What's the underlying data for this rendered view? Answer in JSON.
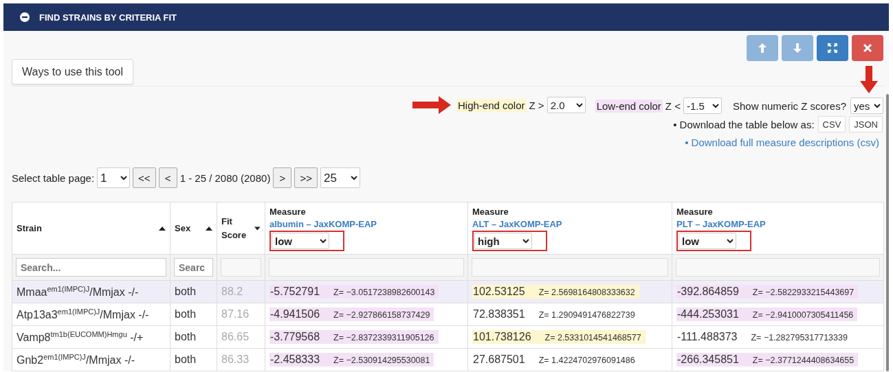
{
  "panel": {
    "title": "FIND STRAINS BY CRITERIA FIT",
    "expanded": true
  },
  "toolbar": [
    {
      "kind": "up",
      "disabled": true
    },
    {
      "kind": "down",
      "disabled": true
    },
    {
      "kind": "expand",
      "disabled": false
    },
    {
      "kind": "close",
      "disabled": false
    }
  ],
  "help_button": "Ways to use this tool",
  "options": [
    {
      "kind": "high",
      "label": "High-end color",
      "operator": "Z >",
      "value": "2.0",
      "arrow_left": true,
      "arrow_above": false
    },
    {
      "kind": "low",
      "label": "Low-end color",
      "operator": "Z <",
      "value": "-1.5",
      "arrow_left": false,
      "arrow_above": false
    },
    {
      "kind": "plain",
      "label": "Show numeric Z scores?",
      "value": "yes",
      "arrow_left": false,
      "arrow_above": true
    }
  ],
  "download": {
    "label": "• Download the table below as:",
    "buttons": [
      "CSV",
      "JSON"
    ],
    "link": "• Download full measure descriptions (csv)"
  },
  "pager": {
    "label": "Select table page:",
    "page": "1",
    "first": "<<",
    "prev": "<",
    "range": "1 - 25 / 2080 (2080)",
    "next": ">",
    "last": ">>",
    "size": "25"
  },
  "table": {
    "columns": [
      {
        "kind": "plain",
        "label": "Strain",
        "sort_descending": false
      },
      {
        "kind": "plain",
        "label": "Sex",
        "sort_descending": false
      },
      {
        "kind": "plain",
        "label": "Fit Score",
        "sort_descending": true
      },
      {
        "kind": "measure",
        "label": "Measure",
        "link": "albumin – JaxKOMP-EAP",
        "value": "low",
        "highlighted": true
      },
      {
        "kind": "measure",
        "label": "Measure",
        "link": "ALT – JaxKOMP-EAP",
        "value": "high",
        "highlighted": true
      },
      {
        "kind": "measure",
        "label": "Measure",
        "link": "PLT – JaxKOMP-EAP",
        "value": "low",
        "highlighted": true
      }
    ],
    "filters": [
      {
        "kind": "search",
        "placeholder": "Search..."
      },
      {
        "kind": "search",
        "placeholder": "Searc"
      },
      {
        "kind": "blank"
      },
      {
        "kind": "blank"
      },
      {
        "kind": "blank"
      },
      {
        "kind": "blank"
      }
    ],
    "rows": [
      {
        "selected": true,
        "strain": "Mmaa$^{em1(IMPC)J}$/Mmjax -/-",
        "sex": "both",
        "fit": "88.2",
        "measures": [
          {
            "value": "-5.752791",
            "z": "Z= −3.0517238982600143",
            "above_high": false,
            "below_low": true
          },
          {
            "value": "102.53125",
            "z": "Z= 2.5698164808333632",
            "above_high": true,
            "below_low": false
          },
          {
            "value": "-392.864859",
            "z": "Z= −2.5822933215443697",
            "above_high": false,
            "below_low": true
          }
        ]
      },
      {
        "selected": false,
        "strain": "Atp13a3$^{em1(IMPC)J}$/Mmjax -/-",
        "sex": "both",
        "fit": "87.16",
        "measures": [
          {
            "value": "-4.941506",
            "z": "Z= −2.927866158737429",
            "above_high": false,
            "below_low": true
          },
          {
            "value": "72.838351",
            "z": "Z= 1.2909491476822739",
            "above_high": false,
            "below_low": false
          },
          {
            "value": "-444.253031",
            "z": "Z= −2.9410007305411456",
            "above_high": false,
            "below_low": true
          }
        ]
      },
      {
        "selected": false,
        "strain": "Vamp8$^{tm1b(EUCOMM)Hmgu}$ -/+",
        "sex": "both",
        "fit": "86.65",
        "measures": [
          {
            "value": "-3.779568",
            "z": "Z= −2.8372339311905126",
            "above_high": false,
            "below_low": true
          },
          {
            "value": "101.738126",
            "z": "Z= 2.5331014541468577",
            "above_high": true,
            "below_low": false
          },
          {
            "value": "-111.488373",
            "z": "Z= −1.282795317713339",
            "above_high": false,
            "below_low": false
          }
        ]
      },
      {
        "selected": false,
        "strain": "Gnb2$^{em1(IMPC)J}$/Mmjax -/-",
        "sex": "both",
        "fit": "86.33",
        "measures": [
          {
            "value": "-2.458333",
            "z": "Z= −2.530914295530081",
            "above_high": false,
            "below_low": true
          },
          {
            "value": "27.687501",
            "z": "Z= 1.4224702976091486",
            "above_high": false,
            "below_low": false
          },
          {
            "value": "-266.345851",
            "z": "Z= −2.3771244408634655",
            "above_high": false,
            "below_low": true
          }
        ]
      }
    ]
  }
}
